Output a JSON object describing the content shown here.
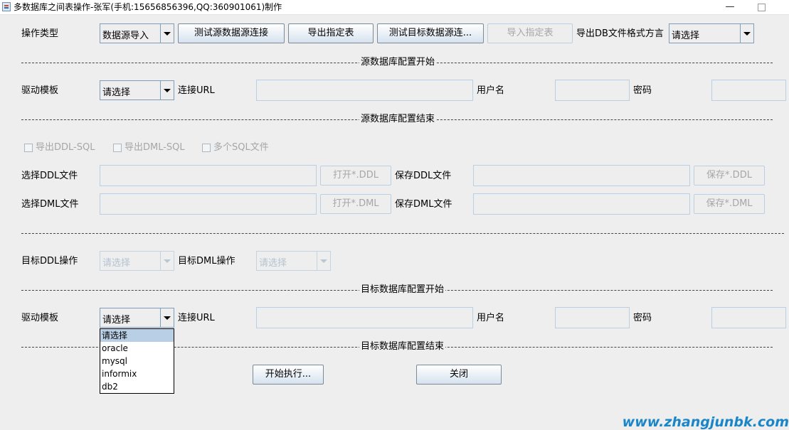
{
  "window": {
    "title": "多数据库之间表操作-张军(手机:15656856396,QQ:360901061)制作",
    "minimize_glyph": "—"
  },
  "top_row": {
    "op_type_label": "操作类型",
    "op_type_value": "数据源导入",
    "test_source_btn": "测试源数据源连接",
    "export_table_btn": "导出指定表",
    "test_target_btn": "测试目标数据源连...",
    "import_table_btn": "导入指定表",
    "db_dialect_label": "导出DB文件格式方言",
    "db_dialect_value": "请选择"
  },
  "source_config": {
    "start_label": "源数据库配置开始",
    "end_label": "源数据库配置结束",
    "driver_label": "驱动模板",
    "driver_value": "请选择",
    "url_label": "连接URL",
    "url_value": "",
    "user_label": "用户名",
    "user_value": "",
    "password_label": "密码",
    "password_value": ""
  },
  "export_options": {
    "ddl_sql_label": "导出DDL-SQL",
    "dml_sql_label": "导出DML-SQL",
    "multi_sql_label": "多个SQL文件",
    "select_ddl_label": "选择DDL文件",
    "open_ddl_btn": "打开*.DDL",
    "save_ddl_label": "保存DDL文件",
    "save_ddl_btn": "保存*.DDL",
    "select_dml_label": "选择DML文件",
    "open_dml_btn": "打开*.DML",
    "save_dml_label": "保存DML文件",
    "save_dml_btn": "保存*.DML"
  },
  "target_ops": {
    "ddl_op_label": "目标DDL操作",
    "ddl_op_value": "请选择",
    "dml_op_label": "目标DML操作",
    "dml_op_value": "请选择"
  },
  "target_config": {
    "start_label": "目标数据库配置开始",
    "end_label": "目标数据库配置结束",
    "driver_label": "驱动模板",
    "driver_value": "请选择",
    "url_label": "连接URL",
    "url_value": "",
    "user_label": "用户名",
    "user_value": "",
    "password_label": "密码",
    "password_value": "",
    "driver_options": [
      "请选择",
      "oracle",
      "mysql",
      "informix",
      "db2"
    ]
  },
  "actions": {
    "start_btn": "开始执行...",
    "close_btn": "关闭"
  },
  "watermark": "www.zhangjunbk.com",
  "colors": {
    "background": "#eeeeee",
    "field_border": "#b8cfe5",
    "combo_border": "#7f9db9",
    "watermark": "#1a86c8",
    "dropdown_selected": "#b8cfe5"
  }
}
